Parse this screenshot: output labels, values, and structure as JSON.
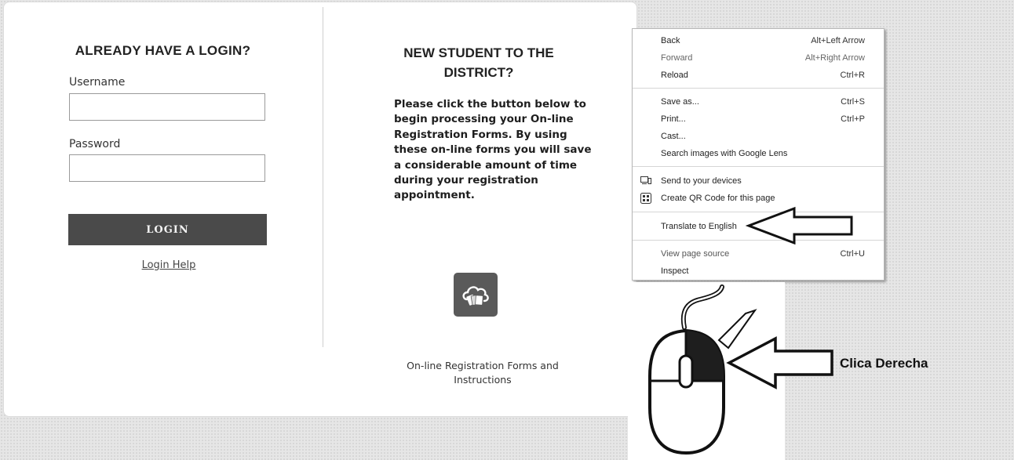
{
  "login": {
    "title": "ALREADY HAVE A LOGIN?",
    "username_label": "Username",
    "username_value": "",
    "password_label": "Password",
    "password_value": "",
    "button_label": "LOGIN",
    "help_link": "Login Help"
  },
  "new_student": {
    "title": "NEW STUDENT TO THE DISTRICT?",
    "body": "Please click the button below to begin processing your On-line Registration Forms. By using these on-line forms you will save a considerable amount of time during your registration appointment.",
    "icon": "cloud-forms-icon",
    "caption": "On-line Registration Forms and Instructions"
  },
  "context_menu": {
    "items": [
      {
        "label": "Back",
        "shortcut": "Alt+Left Arrow"
      },
      {
        "label": "Forward",
        "shortcut": "Alt+Right Arrow"
      },
      {
        "label": "Reload",
        "shortcut": "Ctrl+R"
      },
      {
        "label": "Save as...",
        "shortcut": "Ctrl+S"
      },
      {
        "label": "Print...",
        "shortcut": "Ctrl+P"
      },
      {
        "label": "Cast..."
      },
      {
        "label": "Search images with Google Lens"
      },
      {
        "label": "Send to your devices",
        "icon": "devices-icon"
      },
      {
        "label": "Create QR Code for this page",
        "icon": "qr-code-icon"
      },
      {
        "label": "Translate to English"
      },
      {
        "label": "View page source",
        "shortcut": "Ctrl+U"
      },
      {
        "label": "Inspect"
      }
    ]
  },
  "annotation": {
    "text": "Clica Derecha"
  },
  "colors": {
    "login_button": "#4a4a4a",
    "icon_tile": "#5a5a5a",
    "mouse_button_fill": "#222222"
  }
}
